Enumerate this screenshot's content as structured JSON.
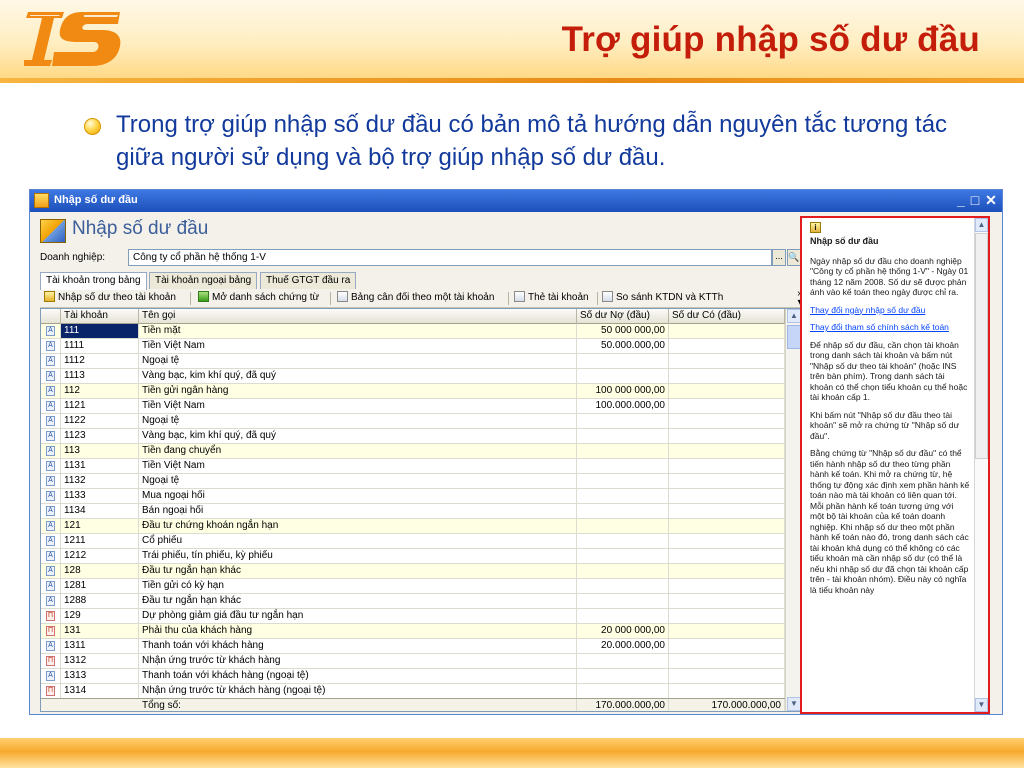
{
  "slide": {
    "title": "Trợ giúp nhập số dư đầu",
    "bullet": "Trong trợ giúp nhập số dư đầu có bản mô tả hướng dẫn nguyên tắc tương tác giữa người sử dụng và bộ trợ giúp nhập số dư đầu."
  },
  "colors": {
    "title": "#c41d0a",
    "bullet_text": "#123a9c",
    "help_border": "#e21c1c",
    "link": "#0645ff"
  },
  "window": {
    "title": "Nhập số dư đầu",
    "minimize": "_",
    "maximize": "□",
    "close": "✕",
    "form_title": "Nhập số dư đầu",
    "company_label": "Doanh nghiệp:",
    "company_value": "Công ty cổ phần hệ thống 1-V",
    "company_more": "...",
    "tabs": [
      "Tài khoản trong bảng",
      "Tài khoản ngoại bảng",
      "Thuế GTGT đầu ra"
    ],
    "toolbar": [
      "Nhập số dư theo tài khoản",
      "Mở danh sách chứng từ",
      "Bảng cân đối theo một tài khoản",
      "Thẻ tài khoản",
      "So sánh KTDN và KTTh"
    ],
    "toolbar_overflow": "»",
    "grid": {
      "columns": [
        "Tài khoản",
        "Tên gọi",
        "Số dư Nợ (đầu)",
        "Số dư Có (đầu)"
      ],
      "rows": [
        {
          "acc": "111",
          "name": "Tiền mặt",
          "debit": "50 000 000,00",
          "credit": "",
          "parent": true
        },
        {
          "acc": "1111",
          "name": "Tiền Việt Nam",
          "debit": "50.000.000,00",
          "credit": "",
          "parent": false
        },
        {
          "acc": "1112",
          "name": "Ngoại tệ",
          "debit": "",
          "credit": "",
          "parent": false
        },
        {
          "acc": "1113",
          "name": "Vàng bạc, kim khí quý, đã quý",
          "debit": "",
          "credit": "",
          "parent": false
        },
        {
          "acc": "112",
          "name": "Tiền gửi ngân hàng",
          "debit": "100 000 000,00",
          "credit": "",
          "parent": true
        },
        {
          "acc": "1121",
          "name": "Tiền Việt Nam",
          "debit": "100.000.000,00",
          "credit": "",
          "parent": false
        },
        {
          "acc": "1122",
          "name": "Ngoại tệ",
          "debit": "",
          "credit": "",
          "parent": false
        },
        {
          "acc": "1123",
          "name": "Vàng bạc, kim khí quý, đã quý",
          "debit": "",
          "credit": "",
          "parent": false
        },
        {
          "acc": "113",
          "name": "Tiền đang chuyển",
          "debit": "",
          "credit": "",
          "parent": true
        },
        {
          "acc": "1131",
          "name": "Tiền Việt Nam",
          "debit": "",
          "credit": "",
          "parent": false
        },
        {
          "acc": "1132",
          "name": "Ngoại tệ",
          "debit": "",
          "credit": "",
          "parent": false
        },
        {
          "acc": "1133",
          "name": "Mua ngoại hối",
          "debit": "",
          "credit": "",
          "parent": false
        },
        {
          "acc": "1134",
          "name": "Bán ngoại hối",
          "debit": "",
          "credit": "",
          "parent": false
        },
        {
          "acc": "121",
          "name": "Đầu tư chứng khoán ngắn hạn",
          "debit": "",
          "credit": "",
          "parent": true
        },
        {
          "acc": "1211",
          "name": "Cổ phiếu",
          "debit": "",
          "credit": "",
          "parent": false
        },
        {
          "acc": "1212",
          "name": "Trái phiếu, tín phiếu, kỳ phiếu",
          "debit": "",
          "credit": "",
          "parent": false
        },
        {
          "acc": "128",
          "name": "Đầu tư ngắn hạn khác",
          "debit": "",
          "credit": "",
          "parent": true
        },
        {
          "acc": "1281",
          "name": "Tiền gửi có kỳ hạn",
          "debit": "",
          "credit": "",
          "parent": false
        },
        {
          "acc": "1288",
          "name": "Đầu tư ngắn hạn khác",
          "debit": "",
          "credit": "",
          "parent": false
        },
        {
          "acc": "129",
          "name": "Dự phòng giảm giá đầu tư ngắn hạn",
          "debit": "",
          "credit": "",
          "parent": false
        },
        {
          "acc": "131",
          "name": "Phải thu của khách hàng",
          "debit": "20 000 000,00",
          "credit": "",
          "parent": true
        },
        {
          "acc": "1311",
          "name": "Thanh toán với khách hàng",
          "debit": "20.000.000,00",
          "credit": "",
          "parent": false
        },
        {
          "acc": "1312",
          "name": "Nhận ứng trước từ khách hàng",
          "debit": "",
          "credit": "",
          "parent": false
        },
        {
          "acc": "1313",
          "name": "Thanh toán với khách hàng (ngoại tệ)",
          "debit": "",
          "credit": "",
          "parent": false
        },
        {
          "acc": "1314",
          "name": "Nhận ứng trước từ khách hàng (ngoại tệ)",
          "debit": "",
          "credit": "",
          "parent": false
        }
      ],
      "total_label": "Tổng số:",
      "total_debit": "170.000.000,00",
      "total_credit": "170.000.000,00"
    }
  },
  "help": {
    "title": "Nhập số dư đầu",
    "p1": "Ngày nhập số dư đầu cho doanh nghiệp \"Công ty cổ phần hệ thống 1-V\" - Ngày 01 tháng 12 năm 2008. Số dư sẽ được phản ánh vào kế toán theo ngày được chỉ ra.",
    "link1": "Thay đổi ngày nhập số dư đầu",
    "link2": "Thay đổi tham số chính sách kế toán",
    "p2": "Để nhập số dư đầu, cần chọn tài khoản trong danh sách tài khoản và bấm nút \"Nhập số dư theo tài khoản\" (hoặc INS trên bàn phím). Trong danh sách tài khoản có thể chọn tiểu khoản cụ thể hoặc tài khoản cấp 1.",
    "p3": "Khi bấm nút \"Nhập số dư đầu theo tài khoản\" sẽ mở ra chứng từ \"Nhập số dư đầu\".",
    "p4": "Bằng chứng từ \"Nhập số dư đầu\" có thể tiến hành nhập số dư theo từng phần hành kế toán. Khi mở ra chứng từ, hệ thống tự động xác định xem phần hành kế toán nào mà tài khoản có liên quan tới. Mỗi phần hành kế toán tương ứng với một bộ tài khoản của kế toán doanh nghiệp. Khi nhập số dư theo một phần hành kế toán nào đó, trong danh sách các tài khoản khả dụng có thể không có các tiểu khoản mà cần nhập số dư (có thể là nếu khi nhập số dư đã chọn tài khoản cấp trên - tài khoản nhóm). Điều này có nghĩa là tiểu khoản này"
  }
}
